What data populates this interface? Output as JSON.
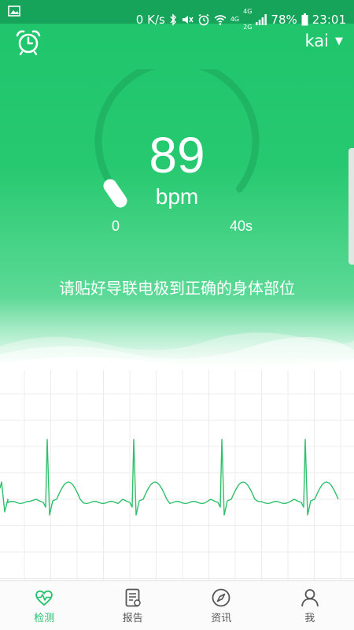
{
  "status_bar": {
    "network_speed": "0 K/s",
    "net_labels": [
      "4G",
      "4G",
      "2G"
    ],
    "battery": "78%",
    "time": "23:01",
    "icons": [
      "image-icon",
      "bluetooth-icon",
      "mute-icon",
      "alarm-icon",
      "wifi-icon",
      "signal-icon",
      "battery-icon"
    ]
  },
  "header": {
    "alarm_icon": "alarm-clock-icon",
    "user_name": "kai",
    "user_caret": "▼"
  },
  "monitor": {
    "heart_rate": "89",
    "unit": "bpm",
    "scale_min": "0",
    "scale_max": "40s",
    "progress_fraction": 0.02,
    "instruction": "请贴好导联电极到正确的身体部位"
  },
  "colors": {
    "primary": "#24c06a",
    "status_bar": "#16a35a",
    "ecg_line": "#2ec06a",
    "grid": "#ececec"
  },
  "tabs": [
    {
      "label": "检测",
      "icon": "heart-rate-icon",
      "active": true
    },
    {
      "label": "报告",
      "icon": "report-icon",
      "active": false
    },
    {
      "label": "资讯",
      "icon": "compass-icon",
      "active": false
    },
    {
      "label": "我",
      "icon": "person-icon",
      "active": false
    }
  ]
}
